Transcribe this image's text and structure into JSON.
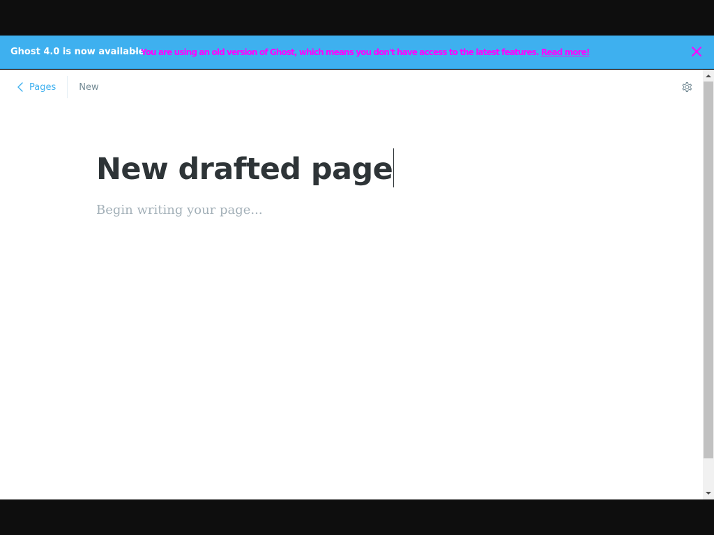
{
  "banner": {
    "title": "Ghost 4.0 is now available",
    "separator": "-",
    "message": "You are using an old version of Ghost, which means you don't have access to the latest features.",
    "link_label": "Read more!",
    "background_color": "#3eb0ef",
    "message_color": "#ff00ff",
    "close_icon": "close-icon"
  },
  "breadcrumb": {
    "back_label": "Pages",
    "status": "New",
    "back_icon": "chevron-left-icon"
  },
  "toolbar": {
    "settings_icon": "gear-icon"
  },
  "editor": {
    "title": "New drafted page",
    "body_placeholder": "Begin writing your page..."
  }
}
